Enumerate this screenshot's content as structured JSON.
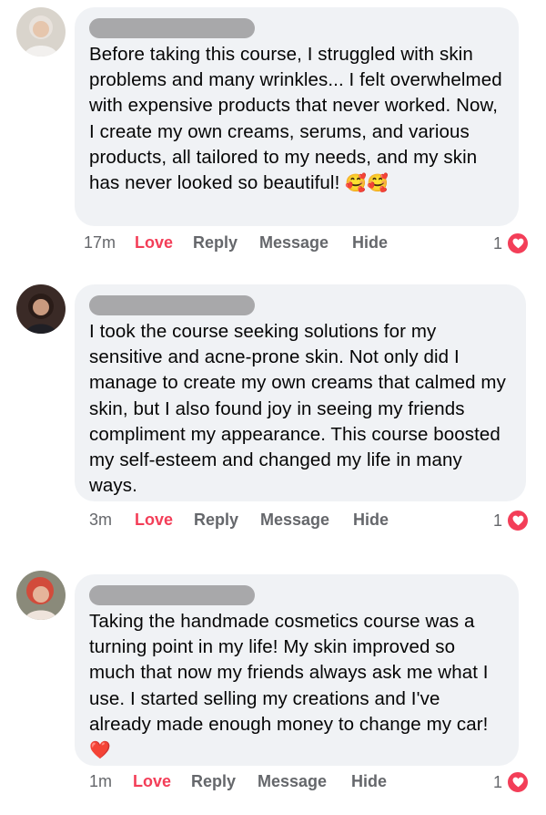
{
  "accent": {
    "love": "#f33e58",
    "bubble": "#f0f2f5",
    "meta": "#65676b"
  },
  "comments": [
    {
      "text": "Before taking this course, I struggled with skin problems and many wrinkles... I felt overwhelmed with expensive products that never worked. Now, I create my own creams, serums, and various products, all tailored to my needs, and my skin has never looked so beautiful!",
      "emoji": "🥰🥰",
      "time": "17m",
      "love_label": "Love",
      "reply_label": "Reply",
      "message_label": "Message",
      "hide_label": "Hide",
      "reaction_count": "1",
      "reaction_icon": "heart-icon"
    },
    {
      "text": "I took the course seeking solutions for my sensitive and acne-prone skin. Not only did I manage to create my own creams that calmed my skin, but I also found joy in seeing my friends compliment my appearance. This course boosted my self-esteem and changed my life in many ways.",
      "emoji": "",
      "time": "3m",
      "love_label": "Love",
      "reply_label": "Reply",
      "message_label": "Message",
      "hide_label": "Hide",
      "reaction_count": "1",
      "reaction_icon": "heart-icon"
    },
    {
      "text": "Taking the handmade cosmetics course was a turning point in my life! My skin improved so much that now my friends always ask me what I use. I started selling my creations and I've already made enough money to change my car!",
      "emoji": "❤️",
      "time": "1m",
      "love_label": "Love",
      "reply_label": "Reply",
      "message_label": "Message",
      "hide_label": "Hide",
      "reaction_count": "1",
      "reaction_icon": "heart-icon"
    }
  ]
}
